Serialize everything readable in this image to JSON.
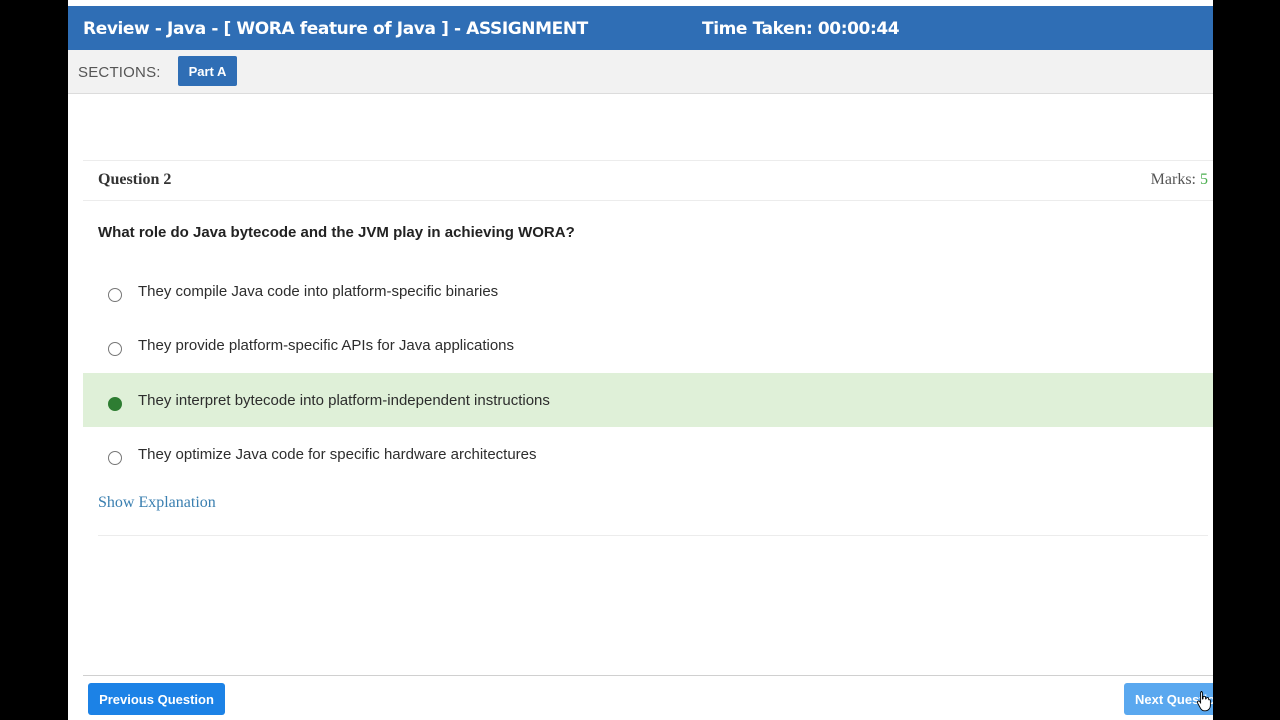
{
  "header": {
    "title": "Review - Java - [ WORA feature of Java ] - ASSIGNMENT",
    "time_taken": "Time Taken: 00:00:44"
  },
  "sections": {
    "label": "SECTIONS:",
    "active": "Part A"
  },
  "question": {
    "number_label": "Question 2",
    "marks_label": "Marks:",
    "marks_value": "5",
    "text": "What role do Java bytecode and the JVM play in achieving WORA?",
    "options": [
      {
        "label": "They compile Java code into platform-specific binaries",
        "selected": false
      },
      {
        "label": "They provide platform-specific APIs for Java applications",
        "selected": false
      },
      {
        "label": "They interpret bytecode into platform-independent instructions",
        "selected": true
      },
      {
        "label": "They optimize Java code for specific hardware architectures",
        "selected": false
      }
    ],
    "explanation_link": "Show Explanation"
  },
  "footer": {
    "prev_label": "Previous Question",
    "next_label": "Next Question"
  },
  "colors": {
    "header_bg": "#2f6eb5",
    "selected_bg": "#dff0d8",
    "selected_radio": "#2e7d32",
    "primary_button": "#1c82e6"
  }
}
